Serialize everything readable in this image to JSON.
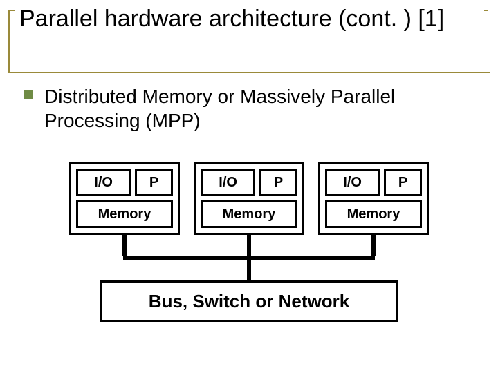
{
  "title": "Parallel hardware architecture (cont. ) [1]",
  "bullet": "Distributed Memory or Massively Parallel Processing (MPP)",
  "diagram": {
    "nodes": [
      {
        "io": "I/O",
        "p": "P",
        "mem": "Memory"
      },
      {
        "io": "I/O",
        "p": "P",
        "mem": "Memory"
      },
      {
        "io": "I/O",
        "p": "P",
        "mem": "Memory"
      }
    ],
    "bus_label": "Bus, Switch or Network"
  }
}
